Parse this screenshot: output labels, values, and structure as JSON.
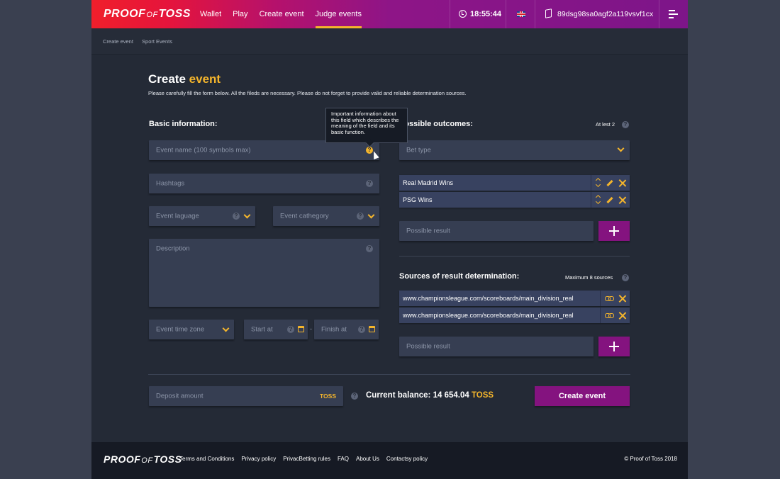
{
  "brand": {
    "logo_left": "PROOF",
    "logo_mid": "OF",
    "logo_right": "TOSS"
  },
  "header": {
    "nav": [
      "Wallet",
      "Play",
      "Create event",
      "Judge events"
    ],
    "active_nav": "Judge events",
    "time": "18:55:44",
    "wallet_address": "89dsg98sa0agf2a119vsvf1cx"
  },
  "breadcrumb": [
    "Create event",
    "Sport Events"
  ],
  "page": {
    "title_main": "Create",
    "title_accent": "event",
    "subtitle": "Please carefully fill the form below. All the fileds are necessary. Please do not forget to provide valid and reliable determination sources."
  },
  "basic": {
    "title": "Basic information:",
    "event_name_placeholder": "Event name (100 symbols max)",
    "hashtags_placeholder": "Hashtags",
    "language_placeholder": "Event laguage",
    "category_placeholder": "Event cathegory",
    "description_placeholder": "Description",
    "timezone_placeholder": "Event time zone",
    "start_placeholder": "Start at",
    "finish_placeholder": "Finish at",
    "dash": "-"
  },
  "tooltip": {
    "text": "Important information about this field which describes the meaning of the field and its basic function."
  },
  "outcomes": {
    "title": "Possible outcomes:",
    "note": "At lest 2",
    "bet_type_placeholder": "Bet type",
    "items": [
      "Real Madrid Wins",
      "PSG Wins"
    ],
    "result_placeholder": "Possible result"
  },
  "sources": {
    "title": "Sources of result determination:",
    "note": "Maximum 8 sources",
    "items": [
      "www.championsleague.com/scoreboards/main_division_real",
      "www.championsleague.com/scoreboards/main_division_real"
    ],
    "result_placeholder": "Possible result"
  },
  "deposit": {
    "placeholder": "Deposit amount",
    "currency": "TOSS",
    "balance_label": "Current balance: 14 654.04",
    "balance_currency": "TOSS",
    "create_button": "Create event"
  },
  "footer": {
    "links": [
      "Terms and Conditions",
      "Privacy policy",
      "PrivacBetting rules",
      "FAQ",
      "About Us",
      "Contactsy policy"
    ],
    "copyright": "© Proof of Toss 2018"
  },
  "colors": {
    "accent": "#f4b52c",
    "button": "#84137f",
    "background": "#242a36"
  }
}
